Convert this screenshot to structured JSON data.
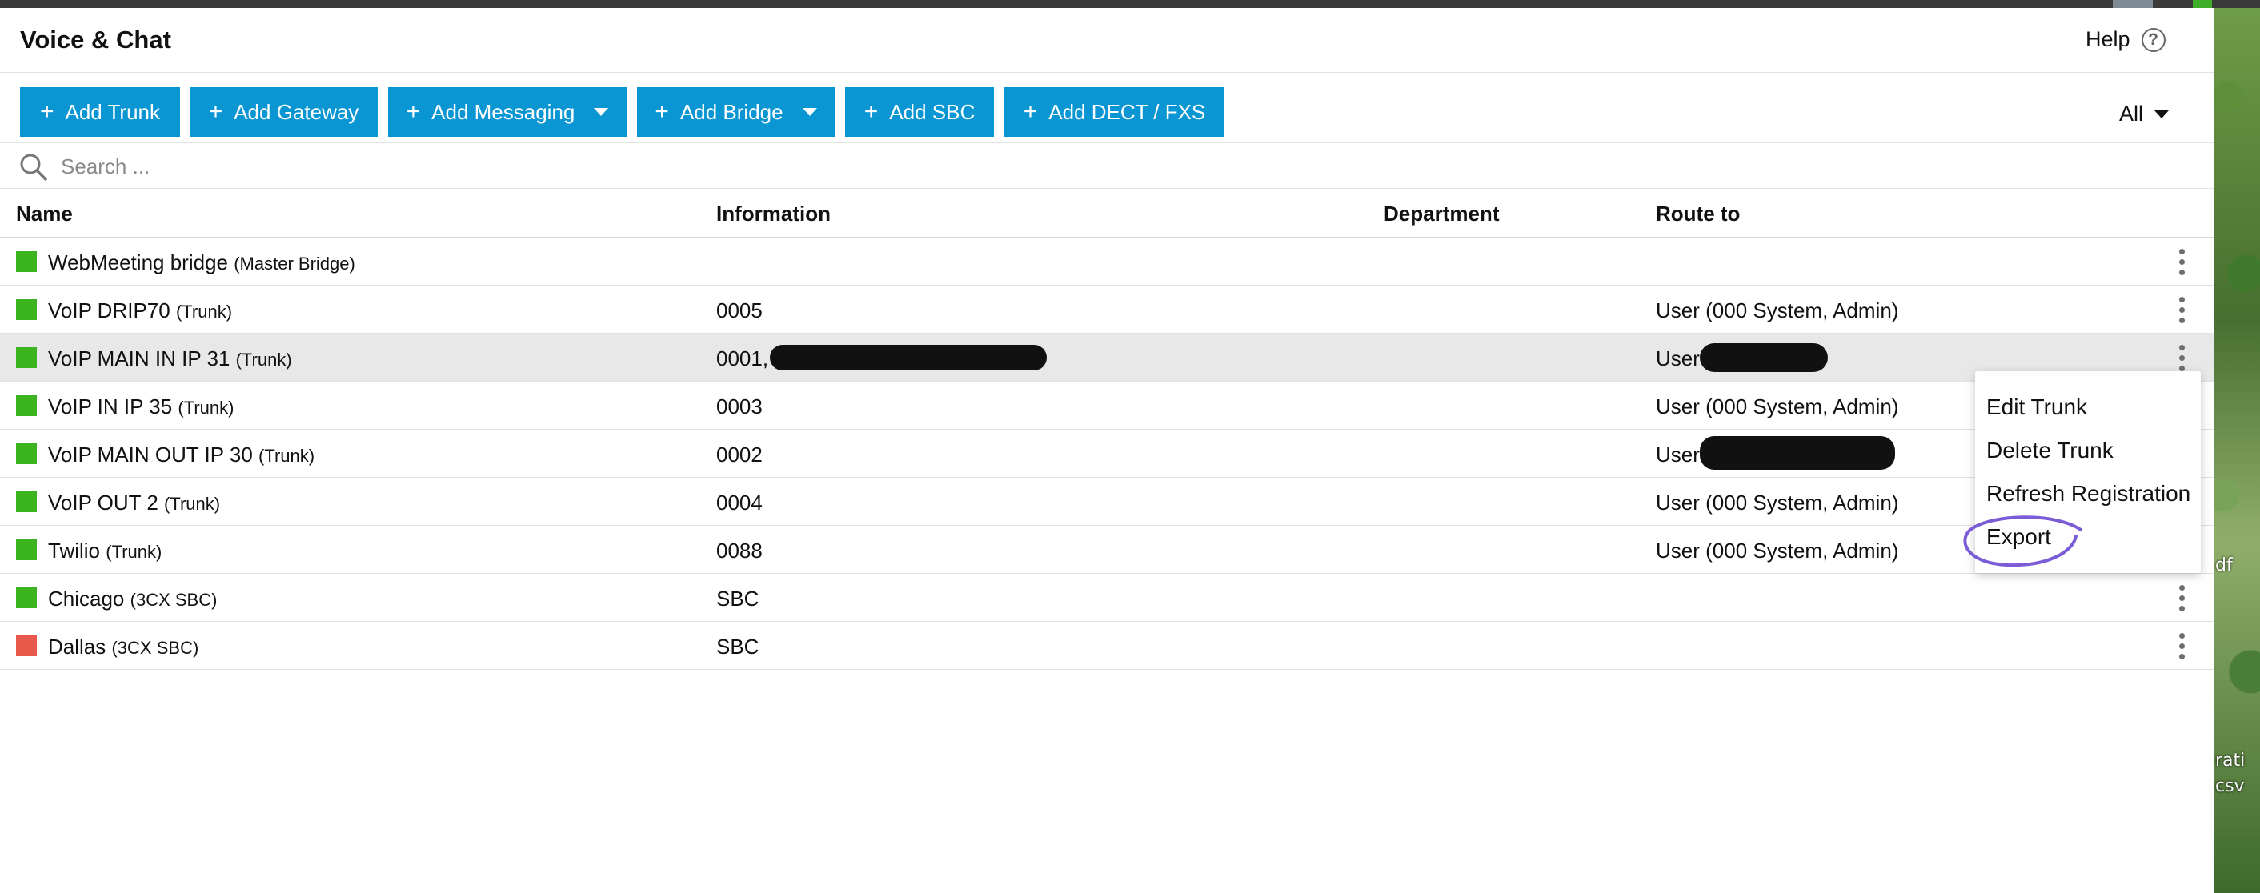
{
  "app": {
    "title": "Voice & Chat",
    "help_label": "Help"
  },
  "toolbar": {
    "buttons": [
      {
        "label": "Add Trunk"
      },
      {
        "label": "Add Gateway"
      },
      {
        "label": "Add Messaging"
      },
      {
        "label": "Add Bridge"
      },
      {
        "label": "Add SBC"
      },
      {
        "label": "Add DECT / FXS"
      }
    ],
    "filter_label": "All"
  },
  "search": {
    "placeholder": "Search ..."
  },
  "table": {
    "headers": [
      "Name",
      "Information",
      "Department",
      "Route to"
    ],
    "rows": [
      {
        "name": "WebMeeting bridge",
        "type": "(Master Bridge)",
        "information": "",
        "department": "",
        "route_to": "",
        "status_color": "#3cb41e"
      },
      {
        "name": "VoIP DRIP70",
        "type": "(Trunk)",
        "information": "0005",
        "department": "",
        "route_to": "User (000 System, Admin)",
        "status_color": "#3cb41e"
      },
      {
        "name": "VoIP MAIN IN IP 31",
        "type": "(Trunk)",
        "information": "0001,",
        "department": "",
        "route_to": "User",
        "status_color": "#3cb41e"
      },
      {
        "name": "VoIP IN IP 35",
        "type": "(Trunk)",
        "information": "0003",
        "department": "",
        "route_to": "User (000 System, Admin)",
        "status_color": "#3cb41e"
      },
      {
        "name": "VoIP MAIN OUT IP 30",
        "type": "(Trunk)",
        "information": "0002",
        "department": "",
        "route_to": "User",
        "status_color": "#3cb41e"
      },
      {
        "name": "VoIP OUT 2",
        "type": "(Trunk)",
        "information": "0004",
        "department": "",
        "route_to": "User (000 System, Admin)",
        "status_color": "#3cb41e"
      },
      {
        "name": "Twilio",
        "type": "(Trunk)",
        "information": "0088",
        "department": "",
        "route_to": "User (000 System, Admin)",
        "status_color": "#3cb41e"
      },
      {
        "name": "Chicago",
        "type": "(3CX SBC)",
        "information": "SBC",
        "department": "",
        "route_to": "",
        "status_color": "#3cb41e"
      },
      {
        "name": "Dallas",
        "type": "(3CX SBC)",
        "information": "SBC",
        "department": "",
        "route_to": "",
        "status_color": "#e8584a"
      }
    ]
  },
  "context_menu": {
    "items": [
      "Edit Trunk",
      "Delete Trunk",
      "Refresh Registration",
      "Export"
    ]
  },
  "colors": {
    "accent": "#0a96d3",
    "status_ok": "#3cb41e",
    "status_error": "#e8584a",
    "annotation": "#7b5cd6"
  },
  "wallpaper_text": [
    "df",
    "rati",
    "csv"
  ]
}
